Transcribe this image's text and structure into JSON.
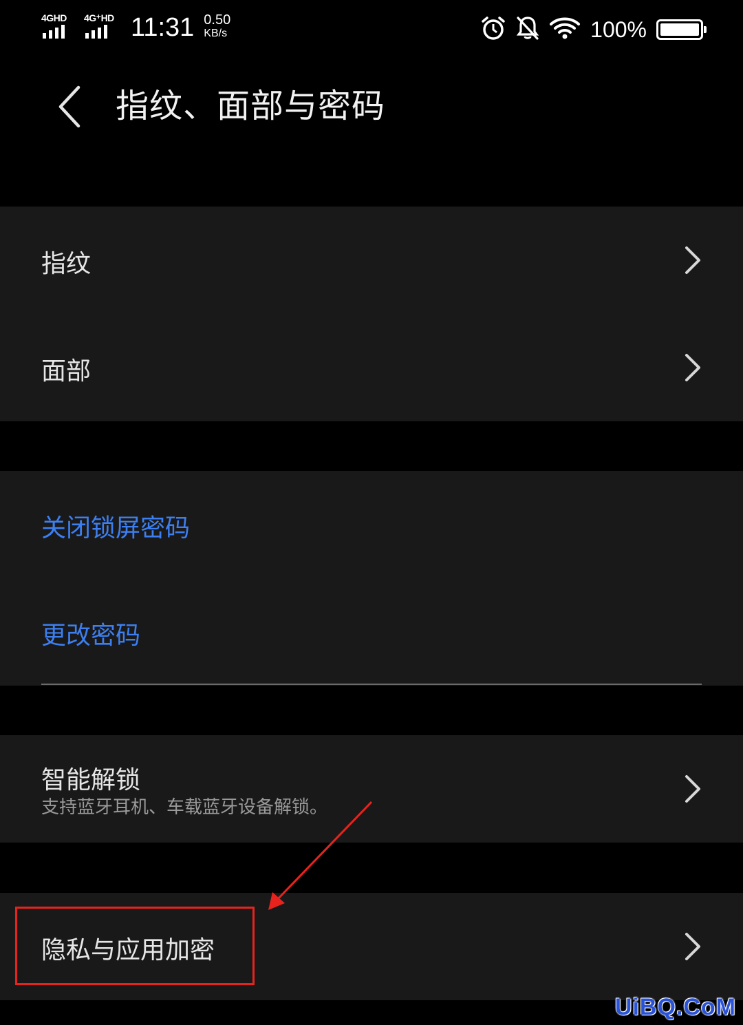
{
  "status_bar": {
    "network1": "4GHD",
    "network2": "4G⁺HD",
    "time": "11:31",
    "speed_value": "0.50",
    "speed_unit": "KB/s",
    "battery_percent": "100%",
    "battery_level": 1.0
  },
  "header": {
    "title": "指纹、面部与密码"
  },
  "biometrics": {
    "items": [
      {
        "label": "指纹"
      },
      {
        "label": "面部"
      }
    ]
  },
  "password": {
    "turn_off": "关闭锁屏密码",
    "change": "更改密码"
  },
  "smart_unlock": {
    "title": "智能解锁",
    "subtitle": "支持蓝牙耳机、车载蓝牙设备解锁。"
  },
  "privacy": {
    "label": "隐私与应用加密"
  },
  "colors": {
    "background": "#000000",
    "card": "#191919",
    "link": "#3d7ff0",
    "annotation": "#e8231d"
  },
  "watermark": "UiBQ.CoM"
}
